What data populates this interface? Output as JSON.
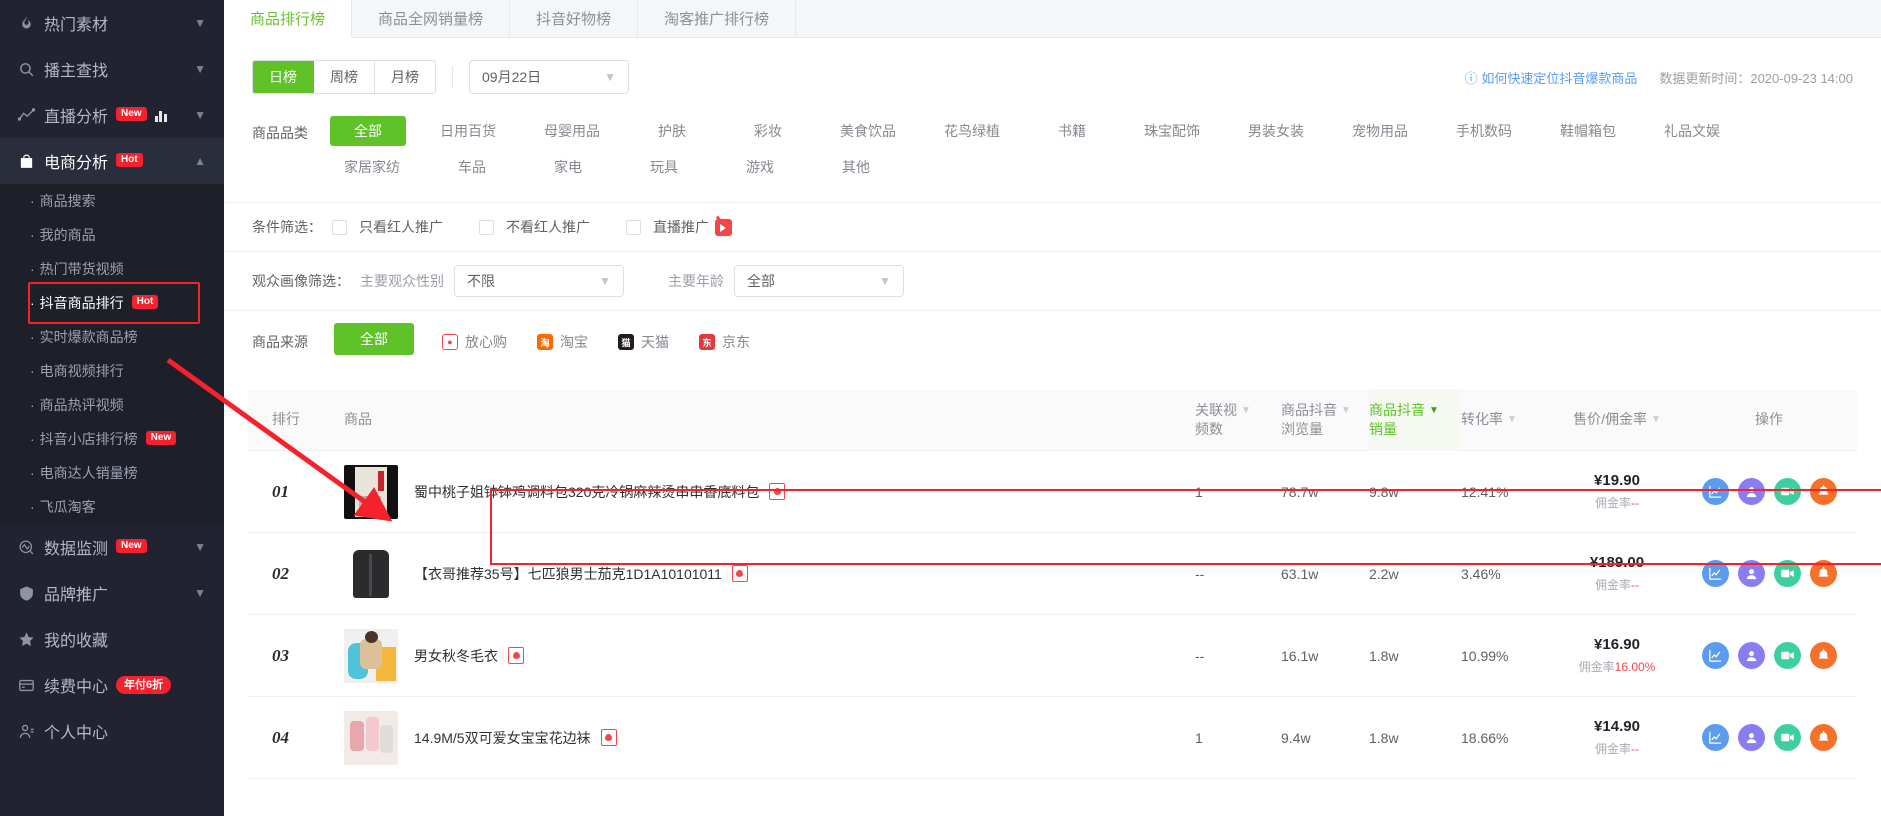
{
  "sidebar": {
    "groups": [
      {
        "label": "热门素材",
        "icon": "fire-icon",
        "badge": "",
        "caret": "chevron-down-icon",
        "active": false,
        "children": []
      },
      {
        "label": "播主查找",
        "icon": "search-icon",
        "badge": "",
        "caret": "chevron-down-icon",
        "active": false,
        "children": []
      },
      {
        "label": "直播分析",
        "icon": "trend-icon",
        "badge": "New",
        "extra_icon": "bar-chart-icon",
        "caret": "chevron-down-icon",
        "active": false,
        "children": []
      },
      {
        "label": "电商分析",
        "icon": "shop-bag-icon",
        "badge": "Hot",
        "caret": "chevron-up-icon",
        "active": true,
        "children": [
          {
            "label": "商品搜索",
            "badge": ""
          },
          {
            "label": "我的商品",
            "badge": ""
          },
          {
            "label": "热门带货视频",
            "badge": ""
          },
          {
            "label": "抖音商品排行",
            "badge": "Hot",
            "highlight": true
          },
          {
            "label": "实时爆款商品榜",
            "badge": ""
          },
          {
            "label": "电商视频排行",
            "badge": ""
          },
          {
            "label": "商品热评视频",
            "badge": ""
          },
          {
            "label": "抖音小店排行榜",
            "badge": "New"
          },
          {
            "label": "电商达人销量榜",
            "badge": ""
          },
          {
            "label": "飞瓜淘客",
            "badge": ""
          }
        ]
      },
      {
        "label": "数据监测",
        "icon": "monitor-icon",
        "badge": "New",
        "caret": "chevron-down-icon",
        "active": false,
        "children": []
      },
      {
        "label": "品牌推广",
        "icon": "shield-icon",
        "badge": "",
        "caret": "chevron-down-icon",
        "active": false,
        "children": []
      },
      {
        "label": "我的收藏",
        "icon": "star-icon",
        "badge": "",
        "caret": "",
        "active": false,
        "children": []
      },
      {
        "label": "续费中心",
        "icon": "card-icon",
        "badge_pill": "年付6折",
        "caret": "",
        "active": false,
        "children": []
      },
      {
        "label": "个人中心",
        "icon": "user-icon",
        "badge": "",
        "caret": "",
        "active": false,
        "children": []
      }
    ]
  },
  "tabs": [
    {
      "label": "商品排行榜",
      "active": true
    },
    {
      "label": "商品全网销量榜",
      "active": false
    },
    {
      "label": "抖音好物榜",
      "active": false
    },
    {
      "label": "淘客推广排行榜",
      "active": false
    }
  ],
  "toolbar": {
    "period": [
      {
        "label": "日榜",
        "active": true
      },
      {
        "label": "周榜",
        "active": false
      },
      {
        "label": "月榜",
        "active": false
      }
    ],
    "date_value": "09月22日",
    "help_link": "如何快速定位抖音爆款商品",
    "help_icon": "question-circle-icon",
    "update_label": "数据更新时间：",
    "update_time": "2020-09-23 14:00"
  },
  "category_filter": {
    "label": "商品品类",
    "items": [
      {
        "label": "全部",
        "active": true
      },
      {
        "label": "日用百货",
        "active": false
      },
      {
        "label": "母婴用品",
        "active": false
      },
      {
        "label": "护肤",
        "active": false
      },
      {
        "label": "彩妆",
        "active": false
      },
      {
        "label": "美食饮品",
        "active": false
      },
      {
        "label": "花鸟绿植",
        "active": false
      },
      {
        "label": "书籍",
        "active": false
      },
      {
        "label": "珠宝配饰",
        "active": false
      },
      {
        "label": "男装女装",
        "active": false
      },
      {
        "label": "宠物用品",
        "active": false
      },
      {
        "label": "手机数码",
        "active": false
      },
      {
        "label": "鞋帽箱包",
        "active": false
      },
      {
        "label": "礼品文娱",
        "active": false
      },
      {
        "label": "家居家纺",
        "active": false
      },
      {
        "label": "车品",
        "active": false
      },
      {
        "label": "家电",
        "active": false
      },
      {
        "label": "玩具",
        "active": false
      },
      {
        "label": "游戏",
        "active": false
      },
      {
        "label": "其他",
        "active": false
      }
    ]
  },
  "condition_filter": {
    "label": "条件筛选：",
    "options": [
      {
        "label": "只看红人推广",
        "checked": false,
        "icon": ""
      },
      {
        "label": "不看红人推广",
        "checked": false,
        "icon": ""
      },
      {
        "label": "直播推广",
        "checked": false,
        "icon": "live-icon"
      }
    ]
  },
  "audience_filter": {
    "label": "观众画像筛选：",
    "gender_label": "主要观众性别",
    "gender_value": "不限",
    "age_label": "主要年龄",
    "age_value": "全部"
  },
  "source_filter": {
    "label": "商品来源",
    "items": [
      {
        "label": "全部",
        "active": true,
        "icon": ""
      },
      {
        "label": "放心购",
        "active": false,
        "icon": "fangxingou-icon"
      },
      {
        "label": "淘宝",
        "active": false,
        "icon": "taobao-icon"
      },
      {
        "label": "天猫",
        "active": false,
        "icon": "tmall-icon"
      },
      {
        "label": "京东",
        "active": false,
        "icon": "jd-icon"
      }
    ]
  },
  "table": {
    "headers": {
      "rank": "排行",
      "product": "商品",
      "video_count_l1": "关联视",
      "video_count_l2": "频数",
      "views_l1": "商品抖音",
      "views_l2": "浏览量",
      "sales_l1": "商品抖音",
      "sales_l2": "销量",
      "conversion": "转化率",
      "price": "售价/佣金率",
      "ops": "操作"
    },
    "rows": [
      {
        "rank": "01",
        "title": "蜀中桃子姐钵钵鸡调料包320克冷锅麻辣烫串串香底料包",
        "tag": "fangxingou-icon",
        "thumb": "th1",
        "video_count": "1",
        "views": "78.7w",
        "sales": "9.8w",
        "conversion": "12.41%",
        "price": "¥19.90",
        "commission_label": "佣金率",
        "commission_value": "--",
        "highlight": true
      },
      {
        "rank": "02",
        "title": "【衣哥推荐35号】七匹狼男士茄克1D1A10101011",
        "tag": "fangxingou-icon",
        "thumb": "th2",
        "video_count": "--",
        "views": "63.1w",
        "sales": "2.2w",
        "conversion": "3.46%",
        "price": "¥189.00",
        "commission_label": "佣金率",
        "commission_value": "--",
        "highlight": false
      },
      {
        "rank": "03",
        "title": "男女秋冬毛衣",
        "tag": "fangxingou-icon",
        "thumb": "th3",
        "video_count": "--",
        "views": "16.1w",
        "sales": "1.8w",
        "conversion": "10.99%",
        "price": "¥16.90",
        "commission_label": "佣金率",
        "commission_value": "16.00%",
        "highlight": false
      },
      {
        "rank": "04",
        "title": "14.9M/5双可爱女宝宝花边袜",
        "tag": "fangxingou-icon",
        "thumb": "th4",
        "video_count": "1",
        "views": "9.4w",
        "sales": "1.8w",
        "conversion": "18.66%",
        "price": "¥14.90",
        "commission_label": "佣金率",
        "commission_value": "--",
        "highlight": false
      }
    ],
    "op_icons": [
      {
        "name": "trend-chart-icon",
        "color": "#5b9bf0"
      },
      {
        "name": "audience-icon",
        "color": "#8a7df0"
      },
      {
        "name": "video-icon",
        "color": "#3ecfa0"
      },
      {
        "name": "monitor-alarm-icon",
        "color": "#f4712c"
      }
    ]
  },
  "colors": {
    "accent_green": "#5ec228",
    "brand_red": "#f5222d",
    "link_blue": "#5a9cf8",
    "sidebar_bg": "#212430"
  }
}
